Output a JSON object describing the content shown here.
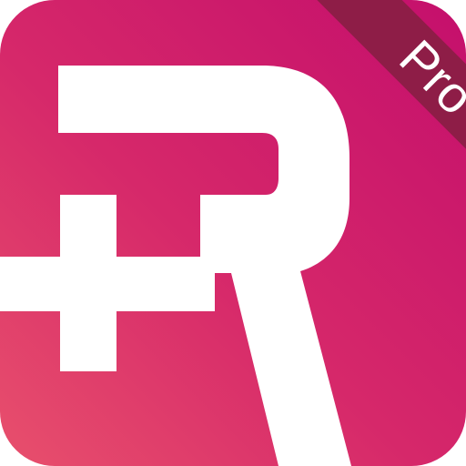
{
  "app_icon": {
    "badge_label": "Pro",
    "colors": {
      "gradient_start": "#e8506c",
      "gradient_end": "#c40f6c",
      "ribbon": "#8e1d47",
      "glyph": "#ffffff"
    }
  }
}
